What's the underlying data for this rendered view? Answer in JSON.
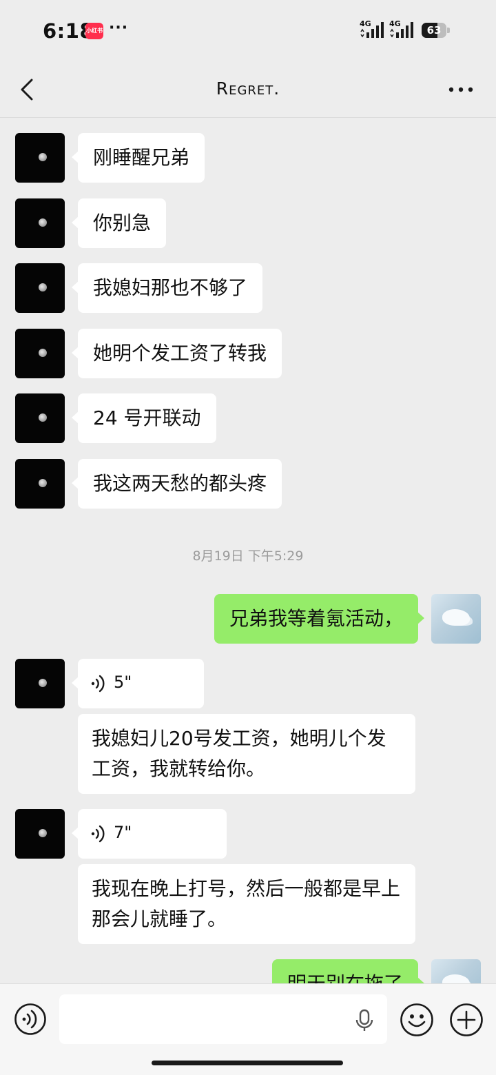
{
  "status_bar": {
    "time": "6:18",
    "app_badge": "小红书",
    "more": "···",
    "network_1": "4G",
    "network_2": "4G",
    "battery": "63",
    "battery_level": 0.63
  },
  "nav": {
    "title": "Regret."
  },
  "messages": [
    {
      "type": "text",
      "direction": "in",
      "text": "刚睡醒兄弟"
    },
    {
      "type": "text",
      "direction": "in",
      "text": "你别急"
    },
    {
      "type": "text",
      "direction": "in",
      "text": "我媳妇那也不够了"
    },
    {
      "type": "text",
      "direction": "in",
      "text": "她明个发工资了转我"
    },
    {
      "type": "text",
      "direction": "in",
      "text": "24 号开联动"
    },
    {
      "type": "text",
      "direction": "in",
      "text": "我这两天愁的都头疼"
    },
    {
      "type": "time",
      "text": "8月19日 下午5:29"
    },
    {
      "type": "text",
      "direction": "out",
      "text": "兄弟我等着氪活动，"
    },
    {
      "type": "voice",
      "direction": "in",
      "duration": "5\"",
      "transcript": "我媳妇儿20号发工资，她明儿个发工资，我就转给你。"
    },
    {
      "type": "voice",
      "direction": "in",
      "duration": "7\"",
      "transcript": "我现在晚上打号，然后一般都是早上那会儿就睡了。"
    },
    {
      "type": "text",
      "direction": "out",
      "text": "明天别在拖了"
    }
  ],
  "input_bar": {
    "placeholder": ""
  },
  "colors": {
    "background": "#ededed",
    "outgoing_bubble": "#95ec69",
    "incoming_bubble": "#ffffff",
    "timestamp_text": "#9b9b9b"
  }
}
